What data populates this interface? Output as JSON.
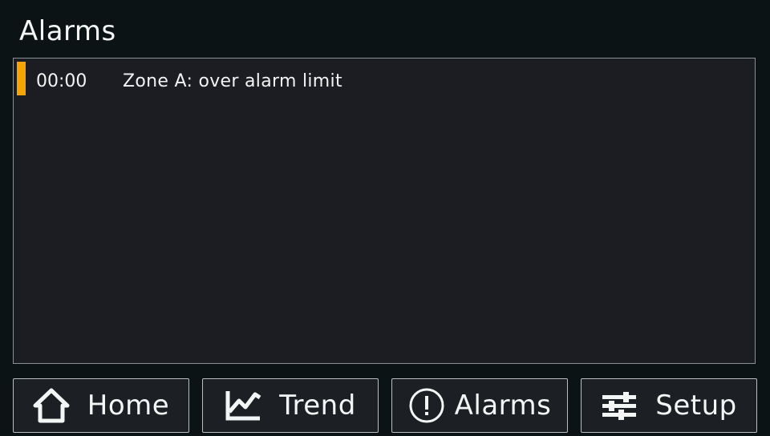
{
  "header": {
    "title": "Alarms"
  },
  "alarms": [
    {
      "time": "00:00",
      "message": "Zone A: over alarm limit",
      "severity_color": "#f5a400"
    }
  ],
  "nav": {
    "home_label": "Home",
    "trend_label": "Trend",
    "alarms_label": "Alarms",
    "setup_label": "Setup",
    "icons": [
      "home-icon",
      "trend-icon",
      "alert-icon",
      "settings-sliders-icon"
    ]
  },
  "colors": {
    "background": "#0c1314",
    "panel": "#1b1d22",
    "accent_warning": "#f5a400",
    "text": "#f2f4f4"
  }
}
